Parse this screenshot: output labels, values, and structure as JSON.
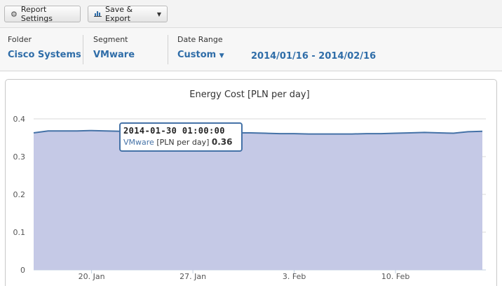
{
  "toolbar": {
    "report_settings_label": "Report Settings",
    "save_export_label": "Save & Export"
  },
  "filters": {
    "folder_label": "Folder",
    "folder_value": "Cisco Systems",
    "segment_label": "Segment",
    "segment_value": "VMware",
    "date_range_label": "Date Range",
    "date_range_value": "Custom",
    "date_range_text": "2014/01/16 - 2014/02/16"
  },
  "colors": {
    "accent": "#2f6da8",
    "series_line": "#4572a7",
    "area_fill": "#c5c9e6"
  },
  "tooltip": {
    "title": "2014-01-30 01:00:00",
    "series": "VMware",
    "unit": "[PLN per day]",
    "value": "0.36"
  },
  "chart_data": {
    "type": "area",
    "title": "Energy Cost [PLN per day]",
    "xlabel": "",
    "ylabel": "",
    "ylim": [
      0,
      0.4
    ],
    "yticks": [
      "0",
      "0.1",
      "0.2",
      "0.3",
      "0.4"
    ],
    "xtick_labels": [
      "20. Jan",
      "27. Jan",
      "3. Feb",
      "10. Feb"
    ],
    "grid": true,
    "legend": "none",
    "series": [
      {
        "name": "VMware",
        "x": [
          "2014-01-16",
          "2014-01-17",
          "2014-01-18",
          "2014-01-19",
          "2014-01-20",
          "2014-01-21",
          "2014-01-22",
          "2014-01-23",
          "2014-01-24",
          "2014-01-25",
          "2014-01-26",
          "2014-01-27",
          "2014-01-28",
          "2014-01-29",
          "2014-01-30",
          "2014-01-31",
          "2014-02-01",
          "2014-02-02",
          "2014-02-03",
          "2014-02-04",
          "2014-02-05",
          "2014-02-06",
          "2014-02-07",
          "2014-02-08",
          "2014-02-09",
          "2014-02-10",
          "2014-02-11",
          "2014-02-12",
          "2014-02-13",
          "2014-02-14",
          "2014-02-15",
          "2014-02-16"
        ],
        "values": [
          0.363,
          0.368,
          0.368,
          0.368,
          0.369,
          0.368,
          0.367,
          0.368,
          0.368,
          0.367,
          0.367,
          0.366,
          0.365,
          0.364,
          0.363,
          0.363,
          0.362,
          0.361,
          0.361,
          0.36,
          0.36,
          0.36,
          0.36,
          0.361,
          0.361,
          0.362,
          0.363,
          0.364,
          0.363,
          0.362,
          0.366,
          0.367
        ]
      }
    ]
  }
}
